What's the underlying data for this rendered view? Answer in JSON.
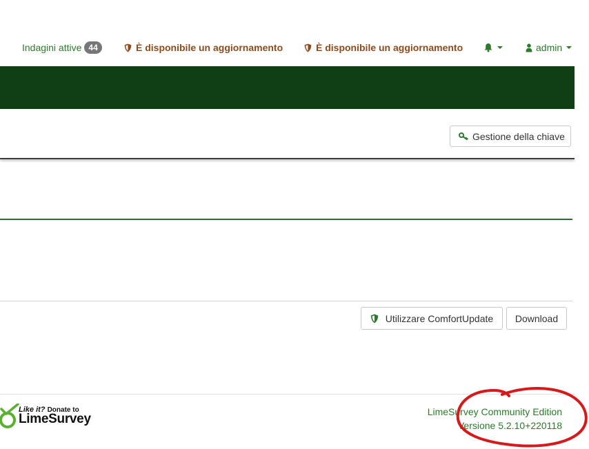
{
  "nav": {
    "active_surveys_label": "Indagini attive",
    "active_surveys_count": "44",
    "update_notice_1": "È disponibile un aggiornamento",
    "update_notice_2": "È disponibile un aggiornamento",
    "user_label": "admin"
  },
  "toolbar": {
    "key_management_label": "Gestione della chiave"
  },
  "actions": {
    "comfort_update_label": "Utilizzare ComfortUpdate",
    "download_label": "Download"
  },
  "footer": {
    "donate_small": "Like it?",
    "donate_to": "Donate to",
    "donate_brand": "LimeSurvey",
    "edition": "LimeSurvey Community Edition",
    "version": "Versione 5.2.10+220118"
  },
  "colors": {
    "header_bar": "#103f14",
    "link_green": "#2c7a2c",
    "update_brown": "#8a4b1f",
    "annotation_red": "#d41a1a"
  },
  "icons": {
    "shield": "shield-icon",
    "bell": "bell-icon",
    "user": "user-icon",
    "key": "key-icon"
  }
}
